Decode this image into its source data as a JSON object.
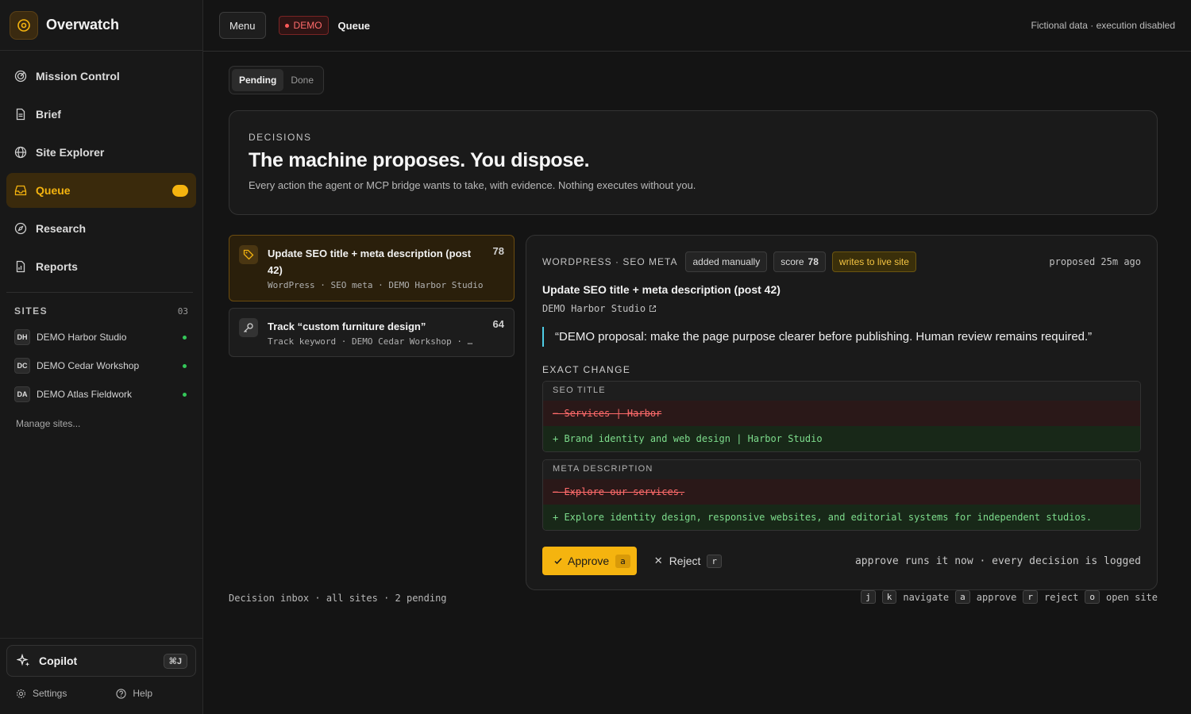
{
  "app": {
    "name": "Overwatch"
  },
  "sidebar": {
    "nav": [
      {
        "label": "Mission Control",
        "icon": "radar-icon"
      },
      {
        "label": "Brief",
        "icon": "document-icon"
      },
      {
        "label": "Site Explorer",
        "icon": "globe-icon"
      },
      {
        "label": "Queue",
        "icon": "inbox-icon",
        "active": true
      },
      {
        "label": "Research",
        "icon": "compass-icon"
      },
      {
        "label": "Reports",
        "icon": "report-icon"
      }
    ],
    "sites_title": "SITES",
    "sites_count": "03",
    "sites": [
      {
        "badge": "DH",
        "name": "DEMO Harbor Studio",
        "status_color": "#34c759"
      },
      {
        "badge": "DC",
        "name": "DEMO Cedar Workshop",
        "status_color": "#34c759"
      },
      {
        "badge": "DA",
        "name": "DEMO Atlas Fieldwork",
        "status_color": "#34c759"
      }
    ],
    "manage_sites": "Manage sites...",
    "copilot": {
      "label": "Copilot",
      "shortcut": "⌘J"
    },
    "settings": "Settings",
    "help": "Help"
  },
  "topbar": {
    "menu": "Menu",
    "demo_badge": "DEMO",
    "crumb": "Queue",
    "note": "Fictional data · execution disabled"
  },
  "tabs": [
    {
      "label": "Pending",
      "active": true
    },
    {
      "label": "Done"
    }
  ],
  "hero": {
    "eyebrow": "DECISIONS",
    "title": "The machine proposes. You dispose.",
    "subtitle": "Every action the agent or MCP bridge wants to take, with evidence. Nothing executes without you."
  },
  "queue": [
    {
      "title": "Update SEO title + meta description (post 42)",
      "meta": "WordPress · SEO meta · DEMO Harbor Studio",
      "score": "78",
      "icon": "tag-icon"
    },
    {
      "title": "Track “custom furniture design”",
      "meta": "Track keyword · DEMO Cedar Workshop · …",
      "score": "64",
      "icon": "key-icon"
    }
  ],
  "detail": {
    "kind": "WORDPRESS · SEO META",
    "chip_added": "added manually",
    "chip_score_label": "score",
    "chip_score_value": "78",
    "chip_live": "writes to live site",
    "proposed": "proposed 25m ago",
    "title": "Update SEO title + meta description (post 42)",
    "site": "DEMO Harbor Studio",
    "quote": "“DEMO proposal: make the page purpose clearer before publishing. Human review remains required.”",
    "exact_change_label": "EXACT CHANGE",
    "diffs": [
      {
        "label": "SEO TITLE",
        "old": "− Services | Harbor",
        "new": "+ Brand identity and web design | Harbor Studio"
      },
      {
        "label": "META DESCRIPTION",
        "old": "− Explore our services.",
        "new": "+ Explore identity design, responsive websites, and editorial systems for independent studios."
      }
    ],
    "approve": "Approve",
    "approve_key": "a",
    "reject": "Reject",
    "reject_key": "r",
    "note": "approve runs it now · every decision is logged"
  },
  "footer": {
    "left": "Decision inbox · all sites · 2 pending",
    "keys": [
      {
        "key": "j"
      },
      {
        "key": "k",
        "label": "navigate"
      },
      {
        "key": "a",
        "label": "approve"
      },
      {
        "key": "r",
        "label": "reject"
      },
      {
        "key": "o",
        "label": "open site"
      }
    ]
  },
  "colors": {
    "accent": "#f5b40f",
    "danger": "#ff6b6b",
    "success": "#7ddc8c",
    "quote_bar": "#4ecde6"
  }
}
